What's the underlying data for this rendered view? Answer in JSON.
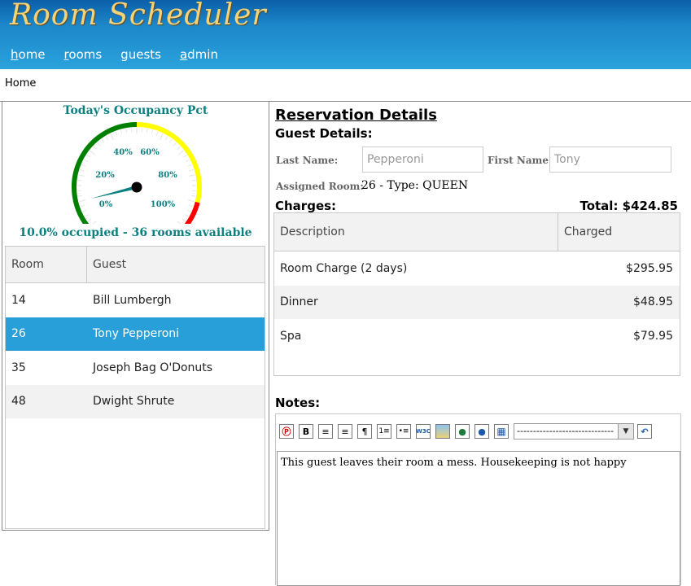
{
  "app": {
    "title": "Room Scheduler"
  },
  "nav": [
    {
      "first": "h",
      "rest": "ome"
    },
    {
      "first": "r",
      "rest": "ooms"
    },
    {
      "first": "g",
      "rest": "uests"
    },
    {
      "first": "a",
      "rest": "dmin"
    }
  ],
  "breadcrumb": "Home",
  "occupancy": {
    "title": "Today's Occupancy Pct",
    "percent": 10.0,
    "summary": "10.0% occupied - 36 rooms available",
    "gauge_labels": [
      "0%",
      "20%",
      "40%",
      "60%",
      "80%",
      "100%"
    ],
    "colors": {
      "green": "#008000",
      "yellow": "#ffff00",
      "red": "#ff0000",
      "needle": "#0b8080"
    }
  },
  "rooms_grid": {
    "headers": {
      "room": "Room",
      "guest": "Guest"
    },
    "rows": [
      {
        "room": "14",
        "guest": "Bill Lumbergh"
      },
      {
        "room": "26",
        "guest": "Tony Pepperoni"
      },
      {
        "room": "35",
        "guest": "Joseph Bag O'Donuts"
      },
      {
        "room": "48",
        "guest": "Dwight Shrute"
      }
    ],
    "selected_room": "26"
  },
  "reservation": {
    "title": "Reservation Details",
    "guest_details_label": "Guest Details:",
    "last_name_label": "Last Name:",
    "last_name": "Pepperoni",
    "first_name_label": "First Name:",
    "first_name": "Tony",
    "assigned_room_label": "Assigned Room:",
    "assigned_room": "26 - Type: QUEEN",
    "charges_label": "Charges:",
    "total": "Total: $424.85",
    "charges_headers": {
      "description": "Description",
      "charged": "Charged"
    },
    "charges": [
      {
        "description": "Room Charge (2 days)",
        "charged": "$295.95"
      },
      {
        "description": "Dinner",
        "charged": "$48.95"
      },
      {
        "description": "Spa",
        "charged": "$79.95"
      }
    ],
    "notes_label": "Notes:",
    "format_select": "------------------------------",
    "notes": "This guest leaves their room a mess. Housekeeping is not happy"
  },
  "toolbar_icons": [
    "paste-icon",
    "bold-icon",
    "align-left-icon",
    "align-right-icon",
    "paragraph-icon",
    "ordered-list-icon",
    "unordered-list-icon",
    "w3c-validate-icon",
    "insert-image-icon",
    "insert-link-icon",
    "remove-link-icon",
    "insert-table-icon",
    "undo-icon"
  ]
}
